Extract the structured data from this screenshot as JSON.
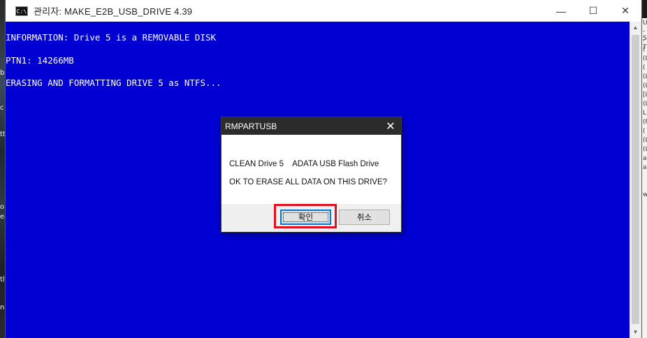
{
  "window": {
    "icon_text": "C:\\",
    "title": "관리자:  MAKE_E2B_USB_DRIVE 4.39",
    "minimize_glyph": "—",
    "maximize_glyph": "☐",
    "close_glyph": "✕"
  },
  "console": {
    "lines": [
      "INFORMATION: Drive 5 is a REMOVABLE DISK",
      "PTN1: 14266MB",
      "ERASING AND FORMATTING DRIVE 5 as NTFS..."
    ]
  },
  "scrollbar": {
    "up_glyph": "▲",
    "down_glyph": "▼"
  },
  "dialog": {
    "title": "RMPARTUSB",
    "close_glyph": "✕",
    "message_line1": "CLEAN Drive 5    ADATA USB Flash Drive",
    "message_line2": "OK TO ERASE ALL DATA ON THIS DRIVE?",
    "ok_label": "확인",
    "cancel_label": "취소"
  },
  "desktop": {
    "left_marks": [
      "b",
      "c",
      "tt",
      "o",
      "ee",
      "tl",
      "n"
    ],
    "right_lines": [
      "U",
      "-S",
      "-T",
      "(",
      "(L",
      "(",
      "(L",
      "(L",
      "[L",
      "(L",
      "L",
      "(F",
      "(",
      "(L",
      "(L",
      "ar",
      "ar",
      "w"
    ]
  },
  "colors": {
    "console_bg": "#0000d2",
    "console_text": "#ffffff",
    "dialog_titlebar": "#2b2b2b",
    "highlight": "#e01020"
  }
}
